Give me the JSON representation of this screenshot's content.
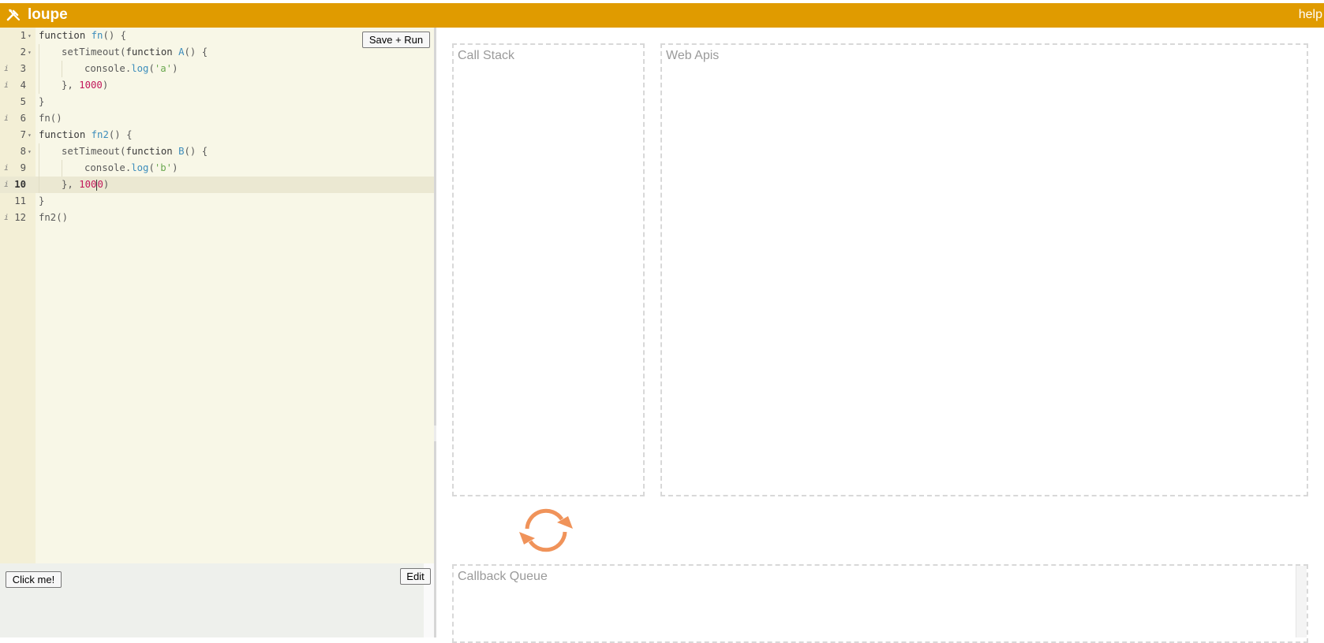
{
  "header": {
    "app_name": "loupe",
    "logo_icon": "tools-icon",
    "help_label": "help",
    "background_color": "#e09b00"
  },
  "editor": {
    "save_run_label": "Save + Run",
    "active_line": 10,
    "lines": [
      {
        "number": "1",
        "foldable": true,
        "info": false
      },
      {
        "number": "2",
        "foldable": true,
        "info": false
      },
      {
        "number": "3",
        "foldable": false,
        "info": true
      },
      {
        "number": "4",
        "foldable": false,
        "info": true
      },
      {
        "number": "5",
        "foldable": false,
        "info": false
      },
      {
        "number": "6",
        "foldable": false,
        "info": true
      },
      {
        "number": "7",
        "foldable": true,
        "info": false
      },
      {
        "number": "8",
        "foldable": true,
        "info": false
      },
      {
        "number": "9",
        "foldable": false,
        "info": true
      },
      {
        "number": "10",
        "foldable": false,
        "info": true
      },
      {
        "number": "11",
        "foldable": false,
        "info": false
      },
      {
        "number": "12",
        "foldable": false,
        "info": true
      }
    ],
    "code": {
      "l1_kw": "function ",
      "l1_name": "fn",
      "l1_rest": "() {",
      "l2_call": "setTimeout(",
      "l2_kw": "function ",
      "l2_name": "A",
      "l2_rest": "() {",
      "l3_obj": "console.",
      "l3_method": "log",
      "l3_open": "(",
      "l3_str": "'a'",
      "l3_close": ")",
      "l4_start": "}, ",
      "l4_num": "1000",
      "l4_end": ")",
      "l5": "}",
      "l6": "fn()",
      "l7_kw": "function ",
      "l7_name": "fn2",
      "l7_rest": "() {",
      "l8_call": "setTimeout(",
      "l8_kw": "function ",
      "l8_name": "B",
      "l8_rest": "() {",
      "l9_obj": "console.",
      "l9_method": "log",
      "l9_open": "(",
      "l9_str": "'b'",
      "l9_close": ")",
      "l10_start": "}, ",
      "l10_num_a": "100",
      "l10_num_b": "0",
      "l10_end": ")",
      "l11": "}",
      "l12": "fn2()"
    },
    "info_glyph": "i",
    "fold_glyph": "▾"
  },
  "output": {
    "click_me_label": "Click me!",
    "edit_label": "Edit"
  },
  "visualizer": {
    "call_stack_title": "Call Stack",
    "web_apis_title": "Web Apis",
    "callback_queue_title": "Callback Queue",
    "event_loop_icon": "refresh-icon",
    "event_loop_color": "#f0935a"
  }
}
